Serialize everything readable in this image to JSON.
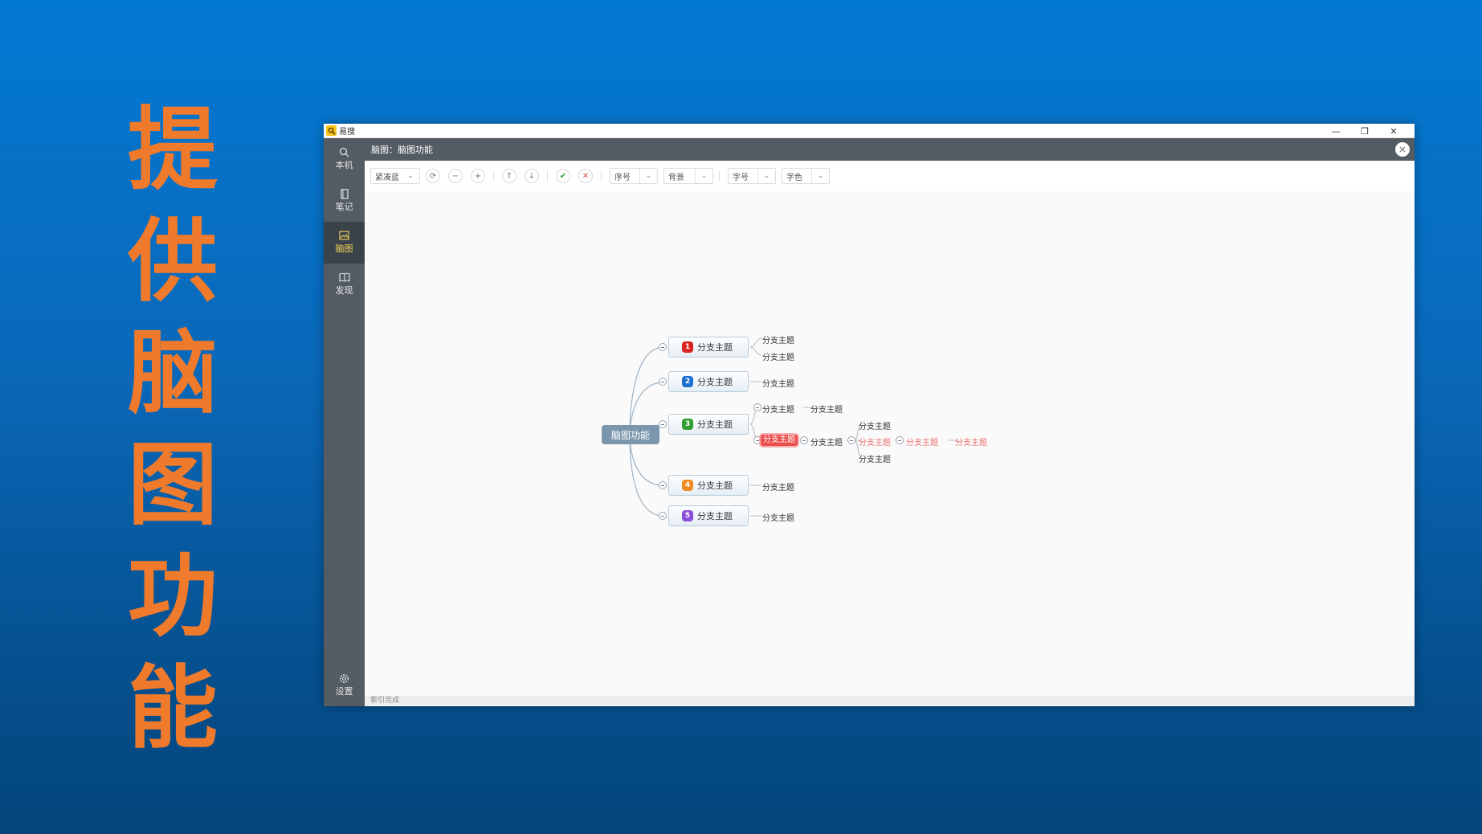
{
  "slide": {
    "title_chars": [
      "提",
      "供",
      "脑",
      "图",
      "功",
      "能"
    ]
  },
  "window": {
    "app_name": "易搜",
    "controls": {
      "minimize": "—",
      "restore": "❐",
      "close": "✕"
    }
  },
  "sidebar": {
    "items": [
      {
        "label": "本机",
        "icon": "search-icon"
      },
      {
        "label": "笔记",
        "icon": "notebook-icon"
      },
      {
        "label": "脑图",
        "icon": "image-icon",
        "active": true
      },
      {
        "label": "发现",
        "icon": "book-icon"
      }
    ],
    "settings": {
      "label": "设置",
      "icon": "gear-icon"
    }
  },
  "content": {
    "title": "脑图：脑图功能",
    "close_icon": "close-icon"
  },
  "toolbar": {
    "layout_select": "紧凑蓝",
    "icons": [
      "refresh-icon",
      "zoom-out-icon",
      "zoom-in-icon",
      "move-up-icon",
      "move-down-icon",
      "check-icon",
      "delete-icon"
    ],
    "dropdowns": [
      "序号",
      "背景",
      "字号",
      "字色"
    ]
  },
  "mindmap": {
    "root": "脑图功能",
    "branches": [
      {
        "number": "1",
        "label": "分支主题",
        "color": "#d9241e",
        "children": [
          "分支主题",
          "分支主题"
        ]
      },
      {
        "number": "2",
        "label": "分支主题",
        "color": "#1f6fd1",
        "children": [
          "分支主题"
        ]
      },
      {
        "number": "3",
        "label": "分支主题",
        "color": "#2f9e2f",
        "children": []
      },
      {
        "number": "4",
        "label": "分支主题",
        "color": "#f08a22",
        "children": [
          "分支主题"
        ]
      },
      {
        "number": "5",
        "label": "分支主题",
        "color": "#8a4fd8",
        "children": [
          "分支主题"
        ]
      }
    ],
    "branch3_detail": {
      "top_child": "分支主题",
      "top_grandchild": "分支主题",
      "selected": "分支主题",
      "level2": "分支主题",
      "level3_top": "分支主题",
      "level3_mid": "分支主题",
      "level3_bottom": "分支主题",
      "level4": "分支主题",
      "level5": "分支主题"
    },
    "accent_color": "#ea4f4f"
  },
  "status": {
    "text": "索引完成"
  }
}
